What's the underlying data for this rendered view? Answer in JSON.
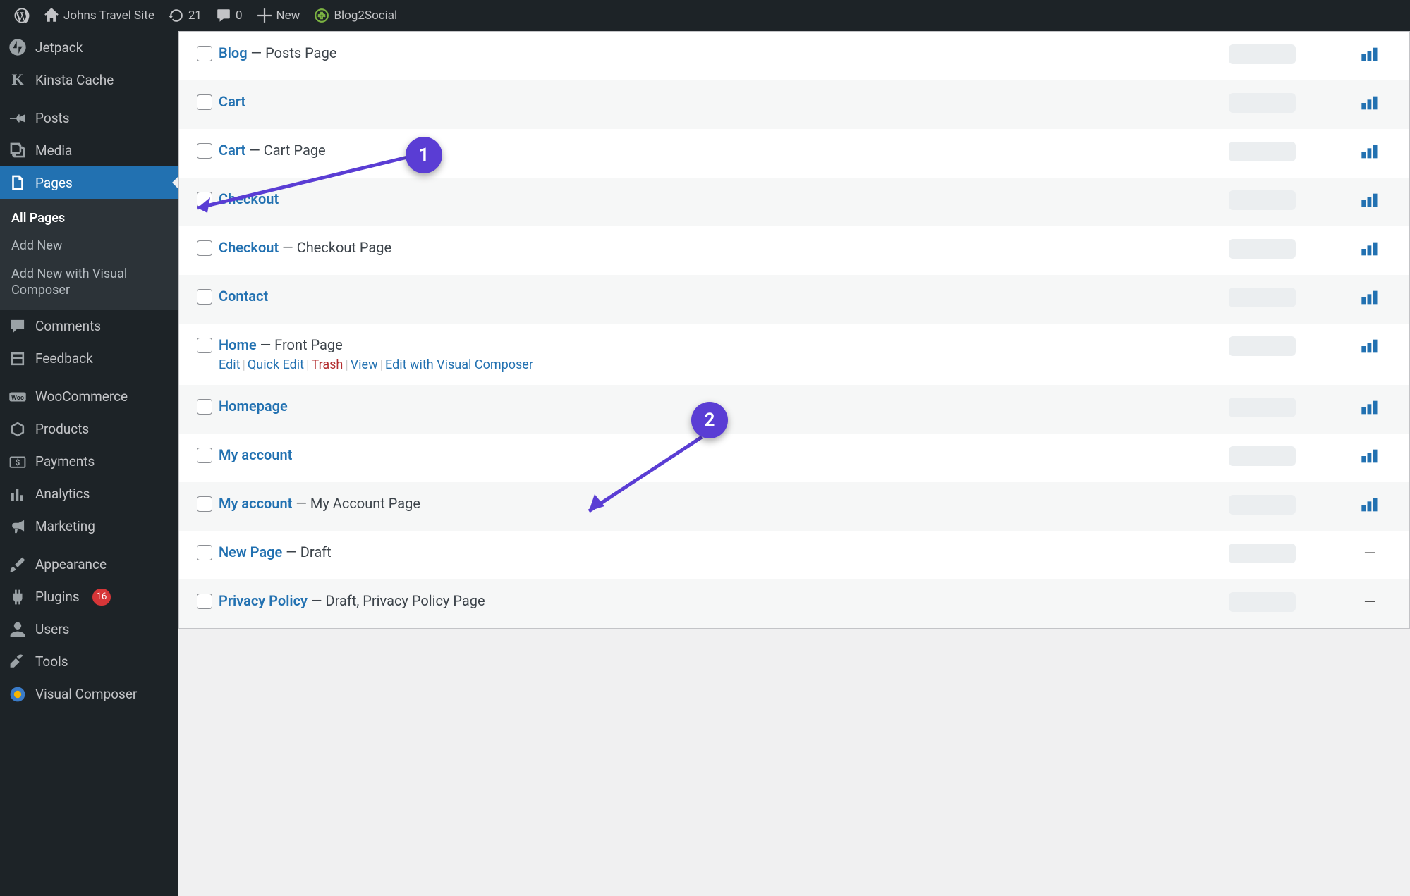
{
  "toolbar": {
    "site_name": "Johns Travel Site",
    "updates_count": "21",
    "comments_count": "0",
    "new_label": "New",
    "blog2social_label": "Blog2Social"
  },
  "sidebar": {
    "jetpack": "Jetpack",
    "kinsta": "Kinsta Cache",
    "posts": "Posts",
    "media": "Media",
    "pages": "Pages",
    "comments": "Comments",
    "feedback": "Feedback",
    "woocommerce": "WooCommerce",
    "products": "Products",
    "payments": "Payments",
    "analytics": "Analytics",
    "marketing": "Marketing",
    "appearance": "Appearance",
    "plugins": "Plugins",
    "plugins_badge": "16",
    "users": "Users",
    "tools": "Tools",
    "visualcomposer": "Visual Composer",
    "submenu": {
      "all_pages": "All Pages",
      "add_new": "Add New",
      "add_new_vc": "Add New with Visual Composer"
    }
  },
  "row_actions": {
    "edit": "Edit",
    "quick_edit": "Quick Edit",
    "trash": "Trash",
    "view": "View",
    "edit_vc": "Edit with Visual Composer"
  },
  "pages": [
    {
      "title": "Blog",
      "suffix": " — Posts Page",
      "stats": true,
      "actions": false
    },
    {
      "title": "Cart",
      "suffix": "",
      "stats": true,
      "actions": false
    },
    {
      "title": "Cart",
      "suffix": " — Cart Page",
      "stats": true,
      "actions": false
    },
    {
      "title": "Checkout",
      "suffix": "",
      "stats": true,
      "actions": false
    },
    {
      "title": "Checkout",
      "suffix": " — Checkout Page",
      "stats": true,
      "actions": false
    },
    {
      "title": "Contact",
      "suffix": "",
      "stats": true,
      "actions": false
    },
    {
      "title": "Home",
      "suffix": " — Front Page",
      "stats": true,
      "actions": true
    },
    {
      "title": "Homepage",
      "suffix": "",
      "stats": true,
      "actions": false
    },
    {
      "title": "My account",
      "suffix": "",
      "stats": true,
      "actions": false
    },
    {
      "title": "My account",
      "suffix": " — My Account Page",
      "stats": true,
      "actions": false
    },
    {
      "title": "New Page",
      "suffix": " — Draft",
      "stats": false,
      "actions": false
    },
    {
      "title": "Privacy Policy",
      "suffix": " — Draft, Privacy Policy Page",
      "stats": false,
      "actions": false
    }
  ],
  "annotations": {
    "one": "1",
    "two": "2"
  }
}
